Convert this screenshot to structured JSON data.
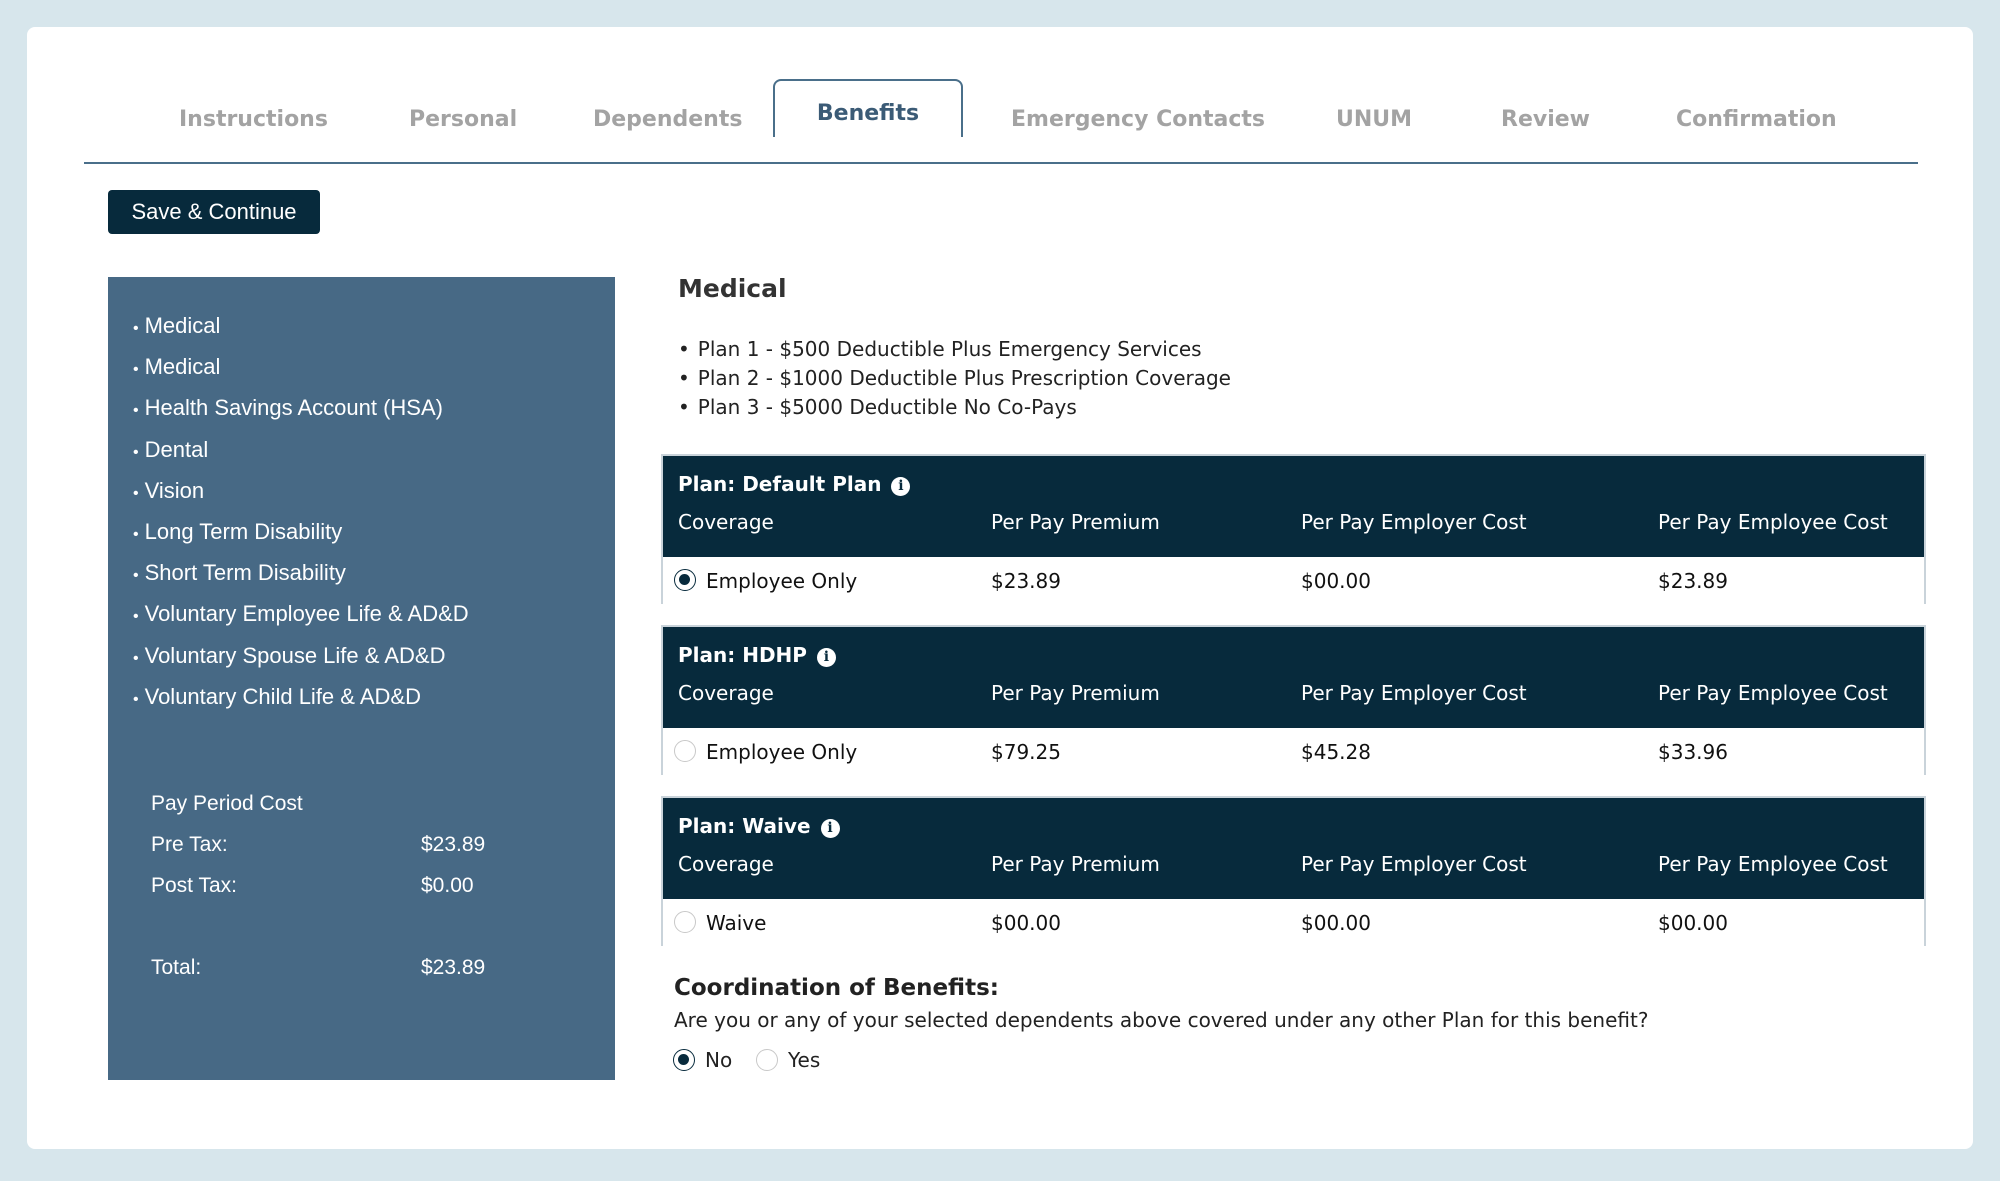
{
  "tabs": [
    {
      "label": "Instructions"
    },
    {
      "label": "Personal"
    },
    {
      "label": "Dependents"
    },
    {
      "label": "Benefits",
      "active": true
    },
    {
      "label": "Emergency Contacts"
    },
    {
      "label": "UNUM"
    },
    {
      "label": "Review"
    },
    {
      "label": "Confirmation"
    }
  ],
  "toolbar": {
    "save_label": "Save & Continue"
  },
  "sidebar": {
    "items": [
      {
        "label": "Medical"
      },
      {
        "label": "Medical"
      },
      {
        "label": "Health Savings Account (HSA)"
      },
      {
        "label": "Dental"
      },
      {
        "label": "Vision"
      },
      {
        "label": "Long Term Disability"
      },
      {
        "label": "Short Term Disability"
      },
      {
        "label": "Voluntary Employee Life & AD&D"
      },
      {
        "label": "Voluntary Spouse Life & AD&D"
      },
      {
        "label": "Voluntary Child Life & AD&D"
      }
    ],
    "cost": {
      "title": "Pay Period Cost",
      "pre_tax_label": "Pre Tax:",
      "pre_tax_value": "$23.89",
      "post_tax_label": "Post Tax:",
      "post_tax_value": "$0.00",
      "total_label": "Total:",
      "total_value": "$23.89"
    }
  },
  "main": {
    "title": "Medical",
    "descriptions": [
      "Plan 1 - $500 Deductible Plus Emergency Services",
      "Plan 2 - $1000 Deductible Plus Prescription Coverage",
      "Plan 3 - $5000 Deductible No Co-Pays"
    ],
    "columns": [
      "Coverage",
      "Per Pay Premium",
      "Per Pay Employer Cost",
      "Per Pay Employee Cost"
    ],
    "plans": [
      {
        "name": "Plan: Default Plan",
        "coverage": "Employee Only",
        "premium": "$23.89",
        "employer": "$00.00",
        "employee": "$23.89",
        "selected": true
      },
      {
        "name": "Plan: HDHP",
        "coverage": "Employee Only",
        "premium": "$79.25",
        "employer": "$45.28",
        "employee": "$33.96",
        "selected": false
      },
      {
        "name": "Plan: Waive",
        "coverage": "Waive",
        "premium": "$00.00",
        "employer": "$00.00",
        "employee": "$00.00",
        "selected": false
      }
    ],
    "cob": {
      "title": "Coordination of Benefits:",
      "question": "Are you or any of your selected dependents above covered under any other Plan for this benefit?",
      "no_label": "No",
      "yes_label": "Yes",
      "selected": "No"
    }
  },
  "icons": {
    "info": "info-icon"
  },
  "colors": {
    "navy": "#072a3c",
    "sidebar": "#476985",
    "background": "#d7e6ec",
    "active_tab": "#3b5b76"
  }
}
